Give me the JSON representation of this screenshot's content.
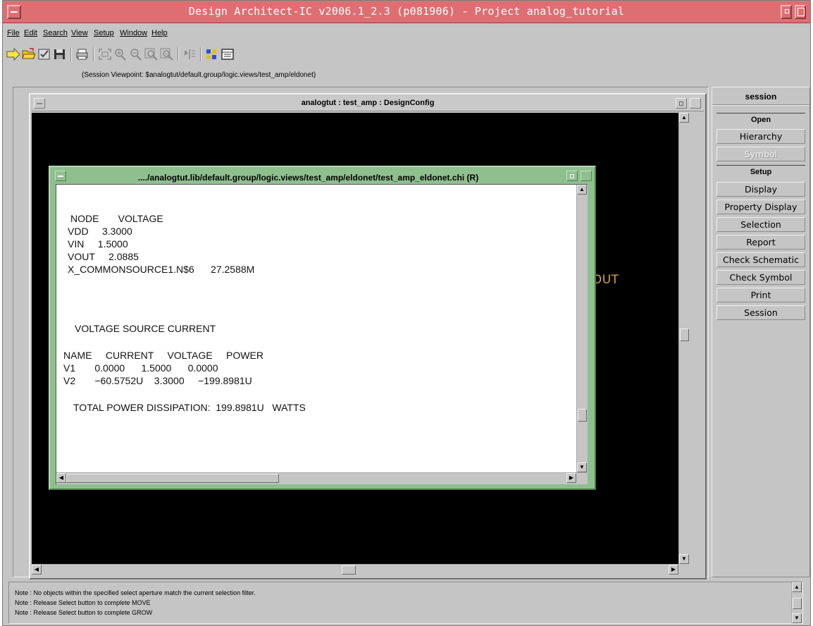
{
  "window": {
    "title": "Design Architect-IC v2006.1_2.3  (p081906)  - Project analog_tutorial",
    "title_color": "#dd6f73"
  },
  "menu": [
    "File",
    "Edit",
    "Search",
    "View",
    "Setup",
    "Window",
    "Help"
  ],
  "toolbar_icons": [
    "open-arrow-icon",
    "open-folder-icon",
    "checkbox-icon",
    "save-disk-icon",
    "print-icon",
    "zoom-fit-icon",
    "zoom-in-icon",
    "zoom-out-icon",
    "zoom-area-icon",
    "zoom-select-icon",
    "run-icon",
    "color-grid-icon",
    "properties-icon"
  ],
  "viewpoint": "(Session Viewpoint: $analogtut/default.group/logic.views/test_amp/eldonet)",
  "design_window": {
    "title": "analogtut : test_amp : DesignConfig",
    "canvas_label": "VOUT",
    "canvas_label_color": "#d7a437"
  },
  "report": {
    "title": "..../analogtut.lib/default.group/logic.views/test_amp/eldonet/test_amp_eldonet.chi (R)",
    "border_color": "#8fbf8f",
    "lines": [
      "NODE       VOLTAGE",
      "VDD     3.3000",
      "VIN     1.5000",
      "VOUT     2.0885",
      "X_COMMONSOURCE1.N$6      27.2588M",
      "VOLTAGE SOURCE CURRENT",
      "NAME     CURRENT     VOLTAGE     POWER",
      "V1       0.0000      1.5000      0.0000",
      "V2       −60.5752U    3.3000     −199.8981U",
      "TOTAL POWER DISSIPATION:  199.8981U   WATTS"
    ]
  },
  "panel": {
    "title": "session",
    "sections": [
      {
        "label": "Open",
        "buttons": [
          "Hierarchy",
          "Symbol"
        ]
      },
      {
        "label": "Setup",
        "buttons": [
          "Display",
          "Property Display",
          "Selection",
          "Report",
          "Check Schematic",
          "Check Symbol",
          "Print",
          "Session"
        ]
      }
    ],
    "disabled": [
      "Symbol"
    ]
  },
  "notes": [
    "Note : No objects within the specified select aperture match the current selection filter.",
    "Note : Release Select button to complete MOVE",
    "Note : Release Select button to complete GROW"
  ]
}
